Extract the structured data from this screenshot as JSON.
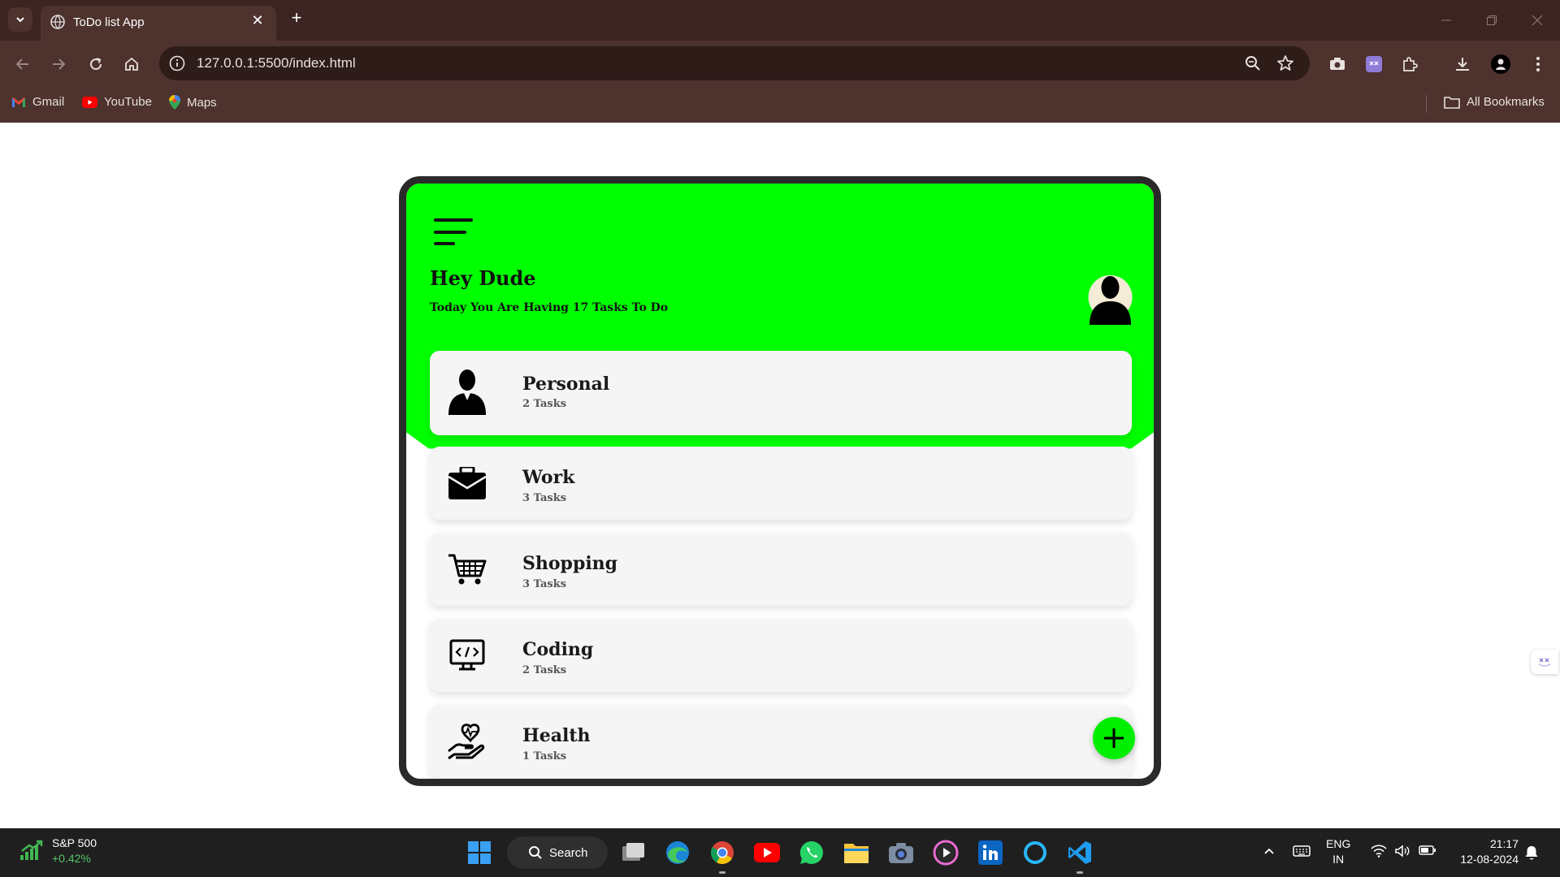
{
  "browser": {
    "tab_title": "ToDo list App",
    "tab_close": "✕",
    "new_tab": "+",
    "url": "127.0.0.1:5500/index.html",
    "bookmarks": [
      {
        "label": "Gmail",
        "icon": "gmail-icon"
      },
      {
        "label": "YouTube",
        "icon": "youtube-icon"
      },
      {
        "label": "Maps",
        "icon": "maps-icon"
      }
    ],
    "all_bookmarks": "All Bookmarks",
    "colors": {
      "frame": "#3b2421",
      "toolbar": "#4d322e"
    }
  },
  "app": {
    "greeting": "Hey Dude",
    "subtitle": "Today You Are Having 17 Tasks To Do",
    "accent_color": "#00ff00",
    "categories": [
      {
        "name": "Personal",
        "count": "2 Tasks",
        "icon": "person-icon"
      },
      {
        "name": "Work",
        "count": "3 Tasks",
        "icon": "briefcase-icon"
      },
      {
        "name": "Shopping",
        "count": "3 Tasks",
        "icon": "cart-icon"
      },
      {
        "name": "Coding",
        "count": "2 Tasks",
        "icon": "code-monitor-icon"
      },
      {
        "name": "Health",
        "count": "1 Tasks",
        "icon": "heart-hand-icon"
      }
    ]
  },
  "taskbar": {
    "stock_name": "S&P 500",
    "stock_change": "+0.42%",
    "search_label": "Search",
    "lang_top": "ENG",
    "lang_bottom": "IN",
    "time": "21:17",
    "date": "12-08-2024"
  }
}
